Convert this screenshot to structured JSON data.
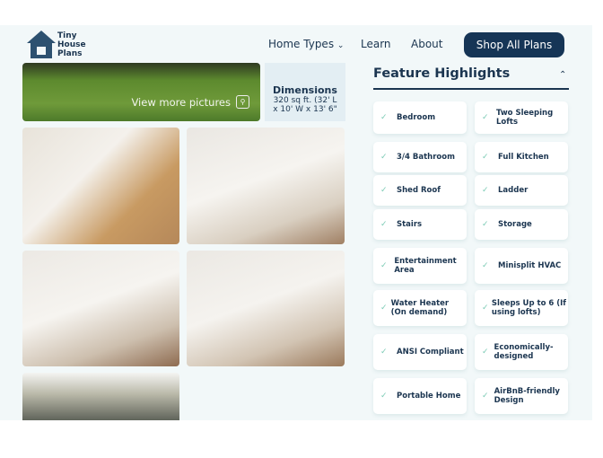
{
  "header": {
    "logo": {
      "line1": "Tiny",
      "line2": "House",
      "line3": "Plans"
    },
    "nav": [
      {
        "label": "Home Types",
        "chevron": "chevron-down-icon"
      },
      {
        "label": "Learn"
      },
      {
        "label": "About"
      }
    ],
    "cta": "Shop All Plans"
  },
  "gallery": {
    "view_more": "View more pictures",
    "dimensions": {
      "title": "Dimensions",
      "line1": "320 sq ft. (32' L",
      "line2": "x 10' W x 13' 6\""
    }
  },
  "features": {
    "title": "Feature Highlights",
    "items": [
      "Bedroom",
      "Two Sleeping Lofts",
      "3/4 Bathroom",
      "Full Kitchen",
      "Shed Roof",
      "Ladder",
      "Stairs",
      "Storage",
      "Entertainment Area",
      "Minisplit HVAC",
      "Water Heater (On demand)",
      "Sleeps Up to 6 (If using lofts)",
      "ANSI Compliant",
      "Economically-designed",
      "Portable Home",
      "AirBnB-friendly Design"
    ]
  },
  "colors": {
    "primary": "#163556",
    "check": "#7ccbb5",
    "background": "#f2f8f9"
  }
}
